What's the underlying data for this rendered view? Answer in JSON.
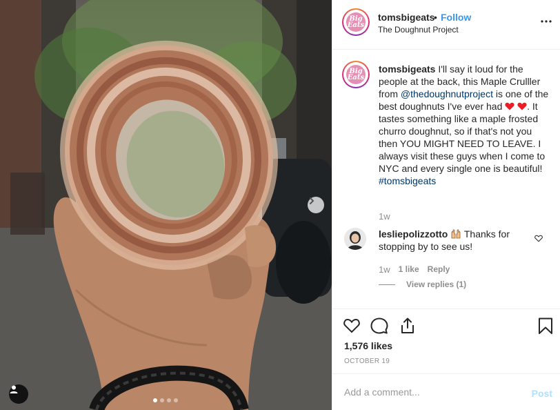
{
  "post": {
    "image_alt": "Maple cruller doughnut held in hand on a city street",
    "carousel": {
      "total": 4,
      "active": 1
    }
  },
  "header": {
    "username": "tomsbigeats",
    "separator": "•",
    "follow_label": "Follow",
    "location": "The Doughnut Project",
    "avatar_text": "Big Eats"
  },
  "caption": {
    "username": "tomsbigeats",
    "text_1": " I'll say it loud for the people at the back, this Maple Crulller from ",
    "mention": "@thedoughnutproject",
    "text_2": " is one of the best doughnuts I've ever had ",
    "text_3": ". It tastes something like a maple frosted churro doughnut, so if that's not you then YOU MIGHT NEED TO LEAVE. I always visit these guys when I come to NYC and every single one is beautiful!",
    "hashtag": "#tomsbigeats",
    "time": "1w"
  },
  "comment": {
    "username": "lesliepolizzotto",
    "text": " Thanks for stopping by to see us!",
    "time": "1w",
    "likes": "1 like",
    "reply_label": "Reply",
    "view_replies": "View replies (1)"
  },
  "stats": {
    "likes": "1,576 likes",
    "date": "OCTOBER 19"
  },
  "add_comment": {
    "placeholder": "Add a comment...",
    "post_label": "Post"
  },
  "colors": {
    "accent": "#3897f0",
    "heart": "#ed1c24",
    "post_disabled": "#b2dffc",
    "muted": "#8e8e8e"
  }
}
